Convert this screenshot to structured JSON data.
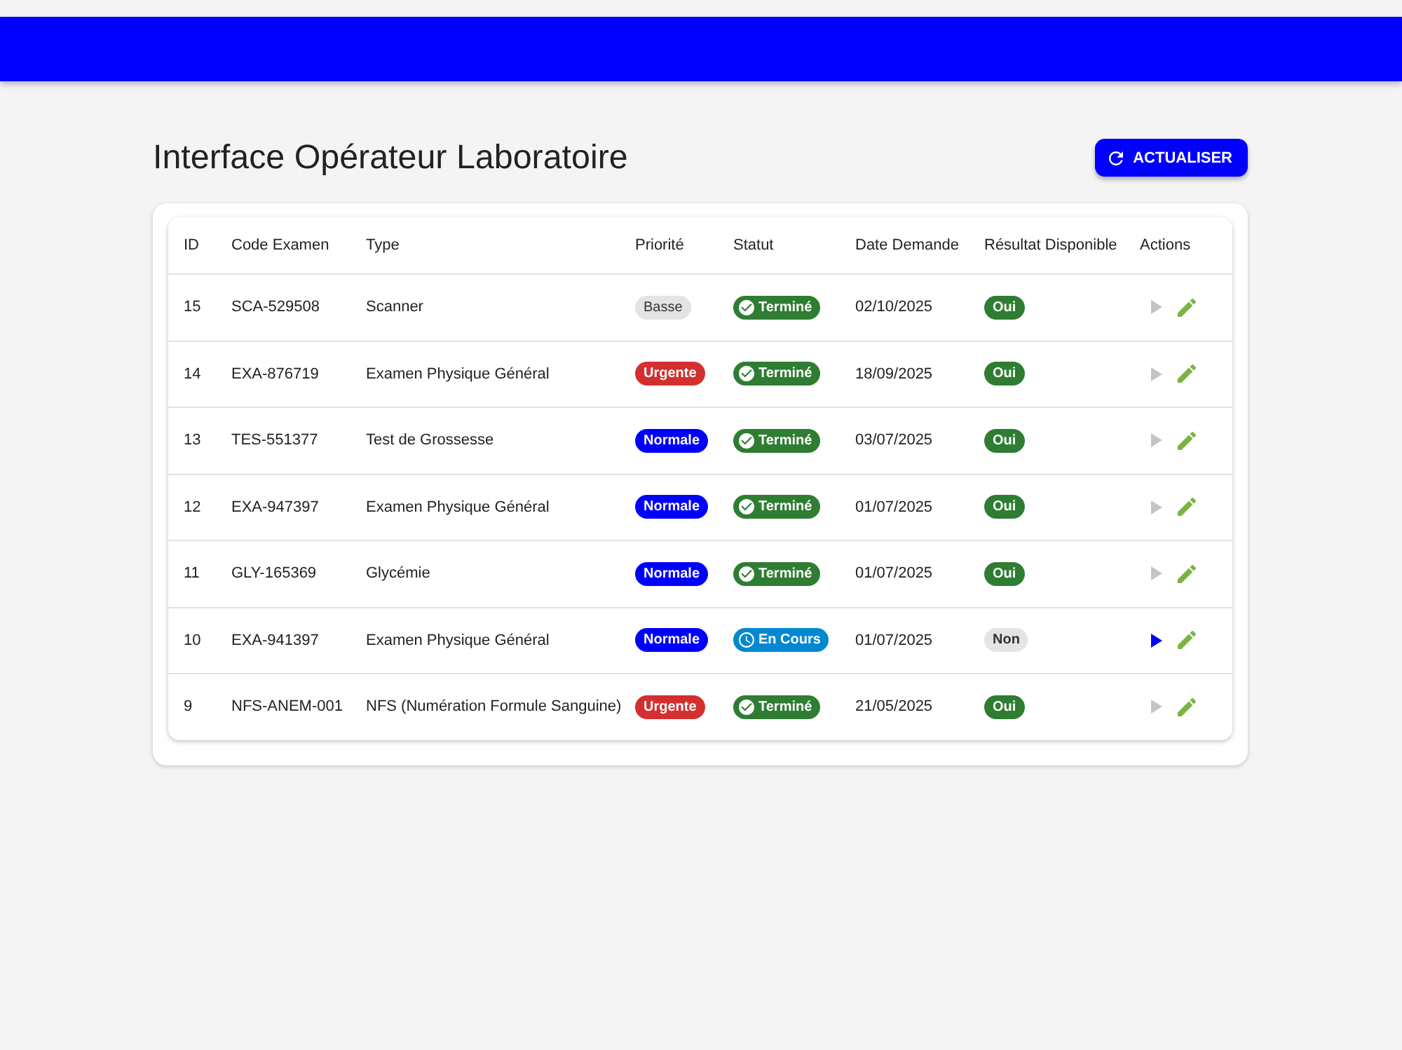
{
  "page": {
    "title": "Interface Opérateur Laboratoire",
    "refresh_button": {
      "label": "ACTUALISER"
    }
  },
  "table": {
    "columns": [
      "ID",
      "Code Examen",
      "Type",
      "Priorité",
      "Statut",
      "Date Demande",
      "Résultat Disponible",
      "Actions"
    ],
    "rows": [
      {
        "id": "15",
        "code": "SCA-529508",
        "type": "Scanner",
        "priority": {
          "label": "Basse",
          "kind": "low"
        },
        "status": {
          "label": "Terminé",
          "kind": "done"
        },
        "date": "02/10/2025",
        "result": {
          "label": "Oui",
          "available": true
        },
        "start_disabled": true
      },
      {
        "id": "14",
        "code": "EXA-876719",
        "type": "Examen Physique Général",
        "priority": {
          "label": "Urgente",
          "kind": "urgent"
        },
        "status": {
          "label": "Terminé",
          "kind": "done"
        },
        "date": "18/09/2025",
        "result": {
          "label": "Oui",
          "available": true
        },
        "start_disabled": true
      },
      {
        "id": "13",
        "code": "TES-551377",
        "type": "Test de Grossesse",
        "priority": {
          "label": "Normale",
          "kind": "normal"
        },
        "status": {
          "label": "Terminé",
          "kind": "done"
        },
        "date": "03/07/2025",
        "result": {
          "label": "Oui",
          "available": true
        },
        "start_disabled": true
      },
      {
        "id": "12",
        "code": "EXA-947397",
        "type": "Examen Physique Général",
        "priority": {
          "label": "Normale",
          "kind": "normal"
        },
        "status": {
          "label": "Terminé",
          "kind": "done"
        },
        "date": "01/07/2025",
        "result": {
          "label": "Oui",
          "available": true
        },
        "start_disabled": true
      },
      {
        "id": "11",
        "code": "GLY-165369",
        "type": "Glycémie",
        "priority": {
          "label": "Normale",
          "kind": "normal"
        },
        "status": {
          "label": "Terminé",
          "kind": "done"
        },
        "date": "01/07/2025",
        "result": {
          "label": "Oui",
          "available": true
        },
        "start_disabled": true
      },
      {
        "id": "10",
        "code": "EXA-941397",
        "type": "Examen Physique Général",
        "priority": {
          "label": "Normale",
          "kind": "normal"
        },
        "status": {
          "label": "En Cours",
          "kind": "in_progress"
        },
        "date": "01/07/2025",
        "result": {
          "label": "Non",
          "available": false
        },
        "start_disabled": false
      },
      {
        "id": "9",
        "code": "NFS-ANEM-001",
        "type": "NFS (Numération Formule Sanguine)",
        "priority": {
          "label": "Urgente",
          "kind": "urgent"
        },
        "status": {
          "label": "Terminé",
          "kind": "done"
        },
        "date": "21/05/2025",
        "result": {
          "label": "Oui",
          "available": true
        },
        "start_disabled": true
      }
    ]
  }
}
